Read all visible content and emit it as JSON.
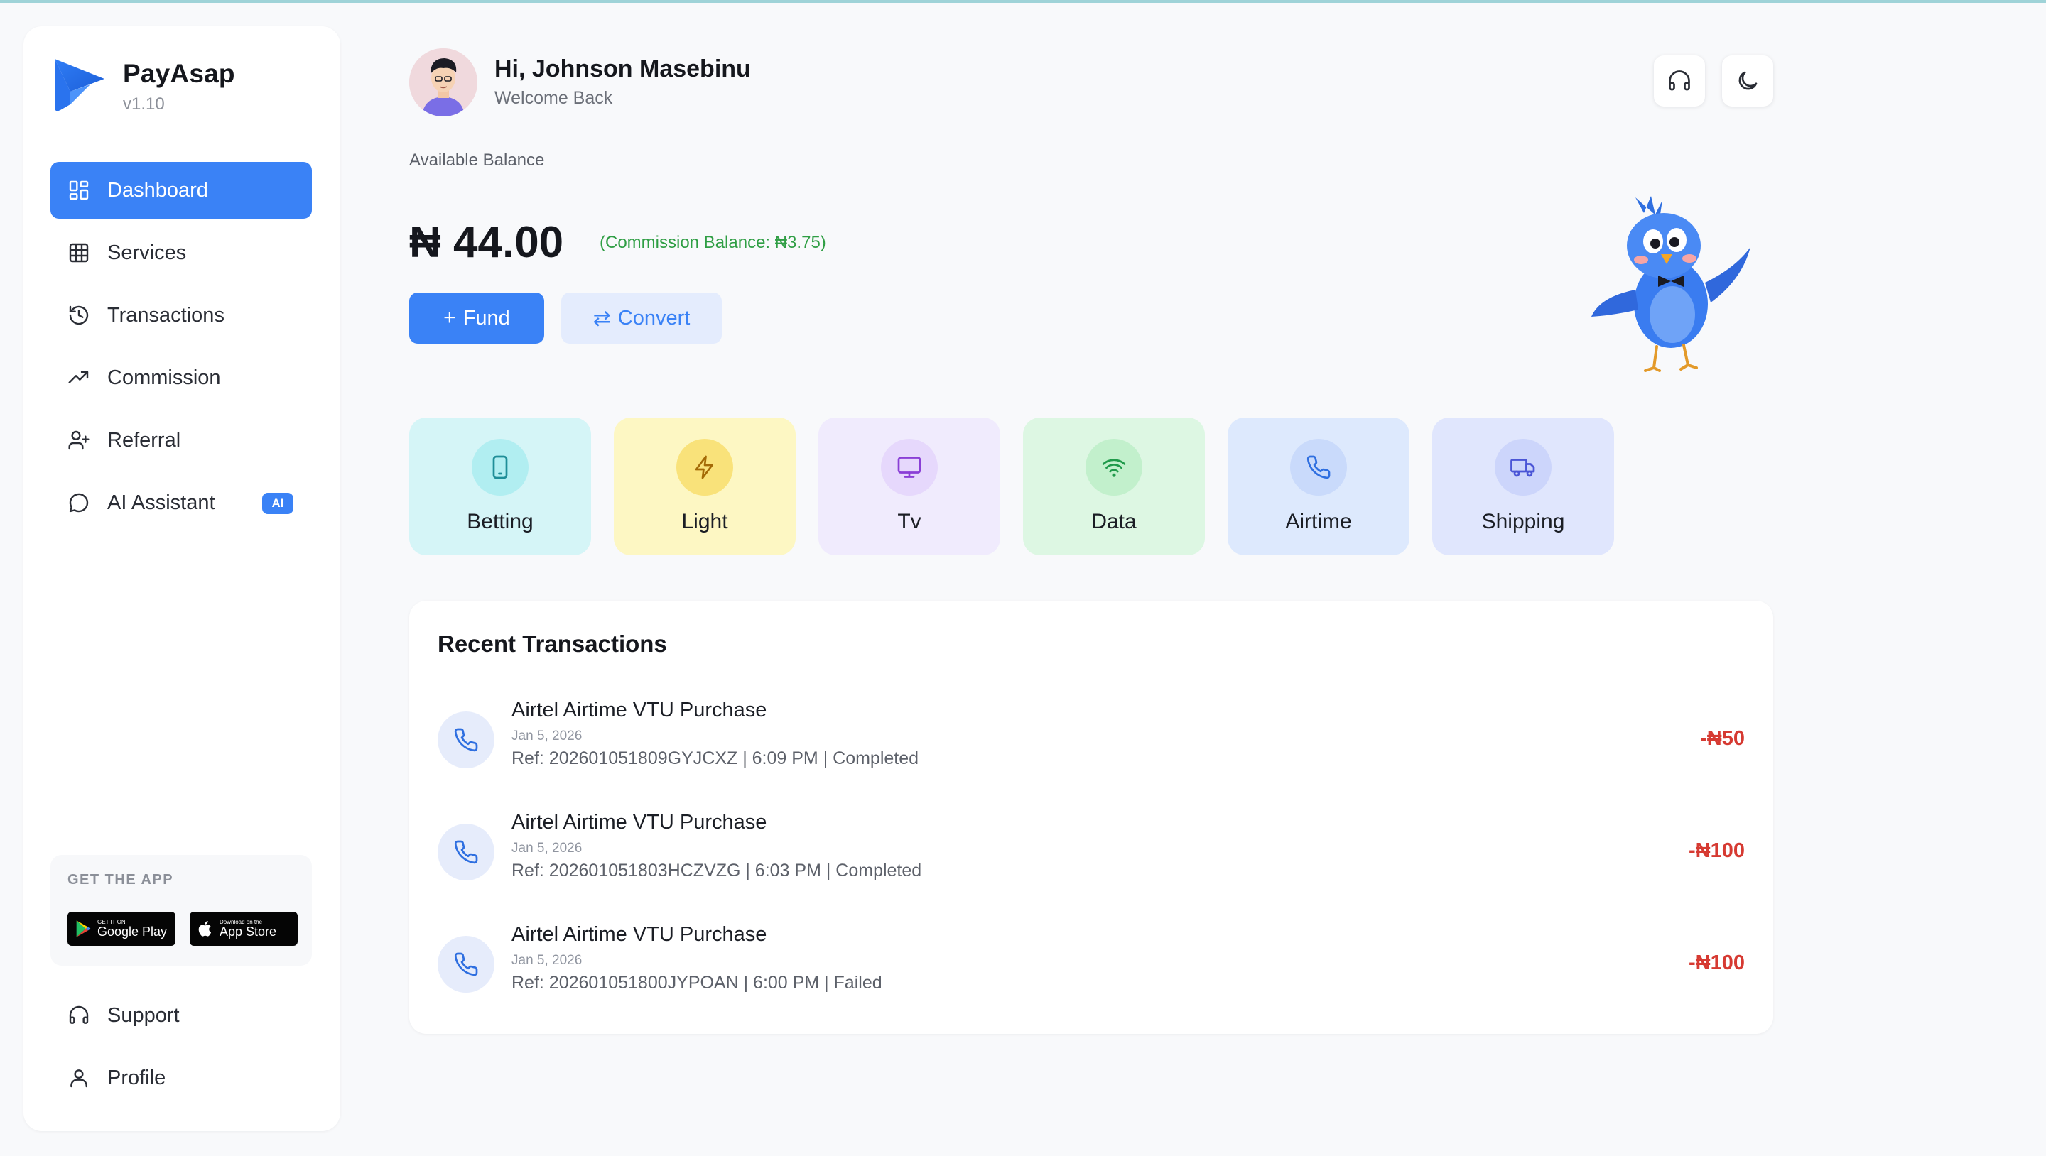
{
  "brand": {
    "name": "PayAsap",
    "version": "v1.10"
  },
  "nav": [
    {
      "label": "Dashboard",
      "icon": "dashboard-icon",
      "active": true
    },
    {
      "label": "Services",
      "icon": "grid-icon"
    },
    {
      "label": "Transactions",
      "icon": "history-icon"
    },
    {
      "label": "Commission",
      "icon": "trending-up-icon"
    },
    {
      "label": "Referral",
      "icon": "user-plus-icon"
    },
    {
      "label": "AI Assistant",
      "icon": "chat-icon",
      "badge": "AI"
    }
  ],
  "get_app": {
    "title": "GET THE APP",
    "google_small": "GET IT ON",
    "google_big": "Google Play",
    "apple_small": "Download on the",
    "apple_big": "App Store"
  },
  "bottom_nav": [
    {
      "label": "Support",
      "icon": "headset-icon"
    },
    {
      "label": "Profile",
      "icon": "user-icon"
    }
  ],
  "header": {
    "greeting": "Hi, Johnson Masebinu",
    "subtitle": "Welcome Back"
  },
  "balance": {
    "label": "Available Balance",
    "amount": "₦ 44.00",
    "commission": "(Commission Balance: ₦3.75)",
    "fund_label": "Fund",
    "convert_label": "Convert"
  },
  "services": [
    {
      "label": "Betting",
      "icon": "phone-device-icon",
      "bg": "#d5f5f7",
      "circle": "#b1eef1",
      "color": "#1f8e98"
    },
    {
      "label": "Light",
      "icon": "lightning-icon",
      "bg": "#fdf7c3",
      "circle": "#f9e27a",
      "color": "#a46a06"
    },
    {
      "label": "Tv",
      "icon": "monitor-icon",
      "bg": "#f0ebfd",
      "circle": "#e6d8fc",
      "color": "#8a3fd6"
    },
    {
      "label": "Data",
      "icon": "wifi-icon",
      "bg": "#ddf7e3",
      "circle": "#c2f0cc",
      "color": "#1f9a4a"
    },
    {
      "label": "Airtime",
      "icon": "phone-icon",
      "bg": "#dde9fd",
      "circle": "#c9dafb",
      "color": "#2f6fe0"
    },
    {
      "label": "Shipping",
      "icon": "truck-icon",
      "bg": "#e0e6fd",
      "circle": "#ccd5fb",
      "color": "#4a55d6"
    }
  ],
  "transactions": {
    "title": "Recent Transactions",
    "items": [
      {
        "name": "Airtel Airtime VTU Purchase",
        "date": "Jan 5, 2026",
        "ref": "Ref: 202601051809GYJCXZ | 6:09 PM | Completed",
        "amount": "-₦50"
      },
      {
        "name": "Airtel Airtime VTU Purchase",
        "date": "Jan 5, 2026",
        "ref": "Ref: 202601051803HCZVZG | 6:03 PM | Completed",
        "amount": "-₦100"
      },
      {
        "name": "Airtel Airtime VTU Purchase",
        "date": "Jan 5, 2026",
        "ref": "Ref: 202601051800JYPOAN | 6:00 PM | Failed",
        "amount": "-₦100"
      }
    ]
  },
  "colors": {
    "accent": "#3a82f6",
    "negative": "#d63a32",
    "commission": "#2f9e44"
  }
}
